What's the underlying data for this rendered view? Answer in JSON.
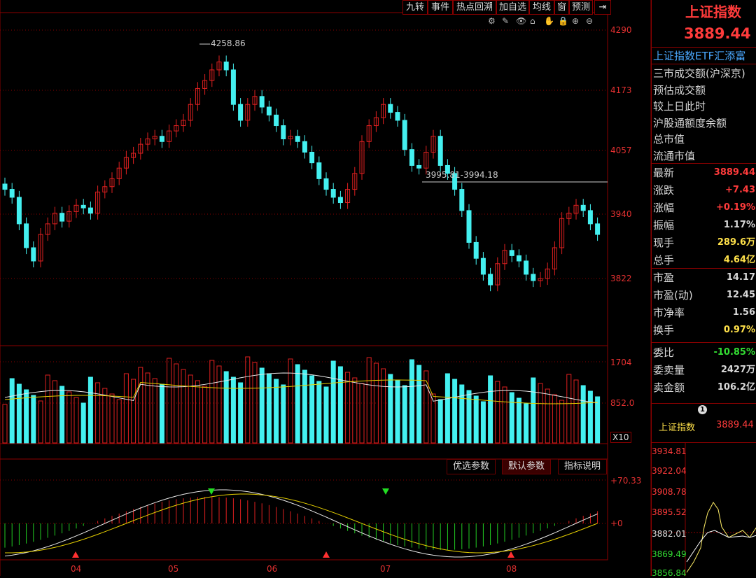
{
  "toolbar": {
    "buttons": [
      "九转",
      "事件",
      "热点回溯",
      "加自选",
      "均线",
      "窗",
      "预测"
    ],
    "tools": [
      "⚙",
      "✎",
      "👁",
      "⌂",
      "✋",
      "🔒",
      "⊕",
      "⊖"
    ]
  },
  "axis": {
    "price_ticks": [
      "4290",
      "4173",
      "4057",
      "3940",
      "3822"
    ],
    "volume_ticks": [
      "1704",
      "852.0"
    ],
    "volume_unit": "X10",
    "macd_ticks": [
      "+70.33",
      "+0"
    ],
    "dates": [
      "04",
      "05",
      "06",
      "07",
      "08"
    ]
  },
  "annotations": {
    "high": "4258.86",
    "range": "3995.81-3994.18"
  },
  "indicator_tabs": [
    "优选参数",
    "默认参数",
    "指标说明"
  ],
  "side": {
    "title": "上证指数",
    "price": "3889.44",
    "ticker": "上证指数ETF汇添富",
    "info_labels": [
      "三市成交额(沪深京)",
      "预估成交额",
      "较上日此时",
      "沪股通额度余额",
      "总市值",
      "流通市值"
    ],
    "quotes1": [
      {
        "k": "最新",
        "v": "3889.44",
        "c": "#ff3b3b"
      },
      {
        "k": "涨跌",
        "v": "+7.43",
        "c": "#ff3b3b"
      },
      {
        "k": "涨幅",
        "v": "+0.19%",
        "c": "#ff3b3b"
      },
      {
        "k": "振幅",
        "v": "1.17%",
        "c": "#d8d8d8"
      },
      {
        "k": "现手",
        "v": "289.6万",
        "c": "#ffe14a"
      },
      {
        "k": "总手",
        "v": "4.64亿",
        "c": "#ffe14a"
      }
    ],
    "quotes2": [
      {
        "k": "市盈",
        "v": "14.17",
        "c": "#d8d8d8"
      },
      {
        "k": "市盈(动)",
        "v": "12.45",
        "c": "#d8d8d8"
      },
      {
        "k": "市净率",
        "v": "1.56",
        "c": "#d8d8d8"
      },
      {
        "k": "换手",
        "v": "0.97%",
        "c": "#ffe14a"
      }
    ],
    "quotes3": [
      {
        "k": "委比",
        "v": "-10.85%",
        "c": "#33dd33"
      },
      {
        "k": "委卖量",
        "v": "2427万",
        "c": "#d8d8d8"
      },
      {
        "k": "卖金额",
        "v": "106.2亿",
        "c": "#d8d8d8"
      }
    ],
    "mini_badge": "1",
    "mini_name": "上证指数",
    "mini_price": "3889.44",
    "mini_ticks": [
      "3934.81",
      "3922.04",
      "3908.78",
      "3895.52",
      "3882.01",
      "3869.49",
      "3856.84"
    ]
  },
  "colors": {
    "up": "#e02020",
    "down": "#44f0f0",
    "ma_white": "#e8e8e8",
    "ma_yellow": "#e6d000",
    "grid": "#8b0000"
  }
}
